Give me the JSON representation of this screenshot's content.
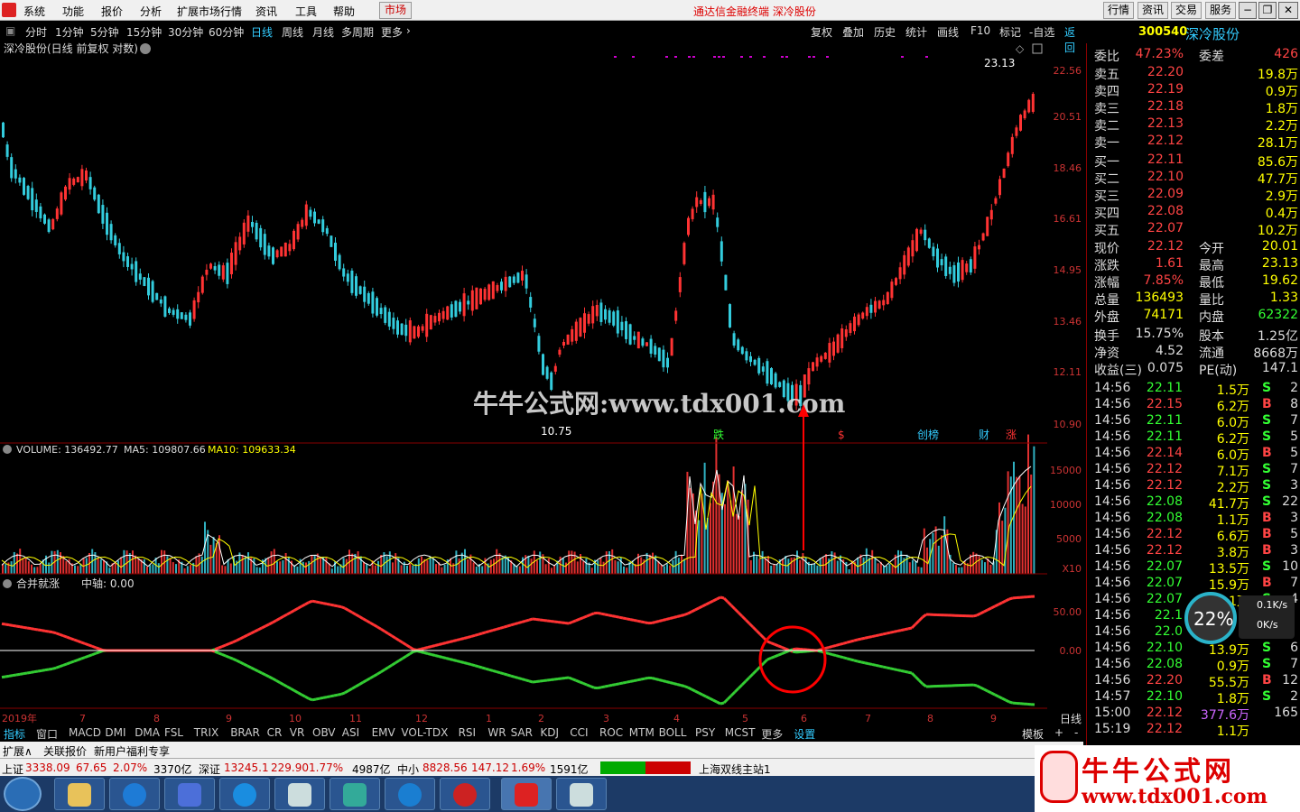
{
  "menu": {
    "items": [
      "系统",
      "功能",
      "报价",
      "分析",
      "扩展市场行情",
      "资讯",
      "工具",
      "帮助"
    ],
    "market": "市场",
    "title": "通达信金融终端  深冷股份",
    "right": [
      "行情",
      "资讯",
      "交易",
      "服务"
    ]
  },
  "toolbar": {
    "periods": [
      "分时",
      "1分钟",
      "5分钟",
      "15分钟",
      "30分钟",
      "60分钟",
      "日线",
      "周线",
      "月线",
      "多周期",
      "更多"
    ],
    "active": "日线",
    "right": [
      "复权",
      "叠加",
      "历史",
      "统计",
      "画线",
      "F10",
      "标记",
      "-自选",
      "返回"
    ]
  },
  "stock": {
    "code": "300540",
    "name": "深冷股份",
    "chart_title": "深冷股份(日线 前复权 对数)"
  },
  "chart_labels": {
    "high": "23.13",
    "low": "10.75",
    "watermark": "牛牛公式网:www.tdx001.com",
    "events": [
      "跌",
      "$",
      "创榜",
      "财",
      "涨"
    ]
  },
  "volume": {
    "title": "VOLUME: 136492.77",
    "ma5": "MA5: 109807.66",
    "ma10": "MA10: 109633.34",
    "unit": "X10"
  },
  "indicator": {
    "name": "合并就涨",
    "axis": "中轴: 0.00",
    "period": "日线"
  },
  "yaxis_price": [
    "22.56",
    "20.51",
    "18.46",
    "16.61",
    "14.95",
    "13.46",
    "12.11",
    "10.90"
  ],
  "yaxis_vol": [
    "15000",
    "10000",
    "5000"
  ],
  "yaxis_ind": [
    "50.00",
    "0.00"
  ],
  "xaxis": [
    "2019年",
    "7",
    "8",
    "9",
    "10",
    "11",
    "12",
    "1",
    "2",
    "3",
    "4",
    "5",
    "6",
    "7",
    "8",
    "9"
  ],
  "quote": {
    "wb": "委比",
    "wb_v": "47.23%",
    "wc": "委差",
    "wc_v": "426",
    "sells": [
      [
        "卖五",
        "22.20",
        "19.8万"
      ],
      [
        "卖四",
        "22.19",
        "0.9万"
      ],
      [
        "卖三",
        "22.18",
        "1.8万"
      ],
      [
        "卖二",
        "22.13",
        "2.2万"
      ],
      [
        "卖一",
        "22.12",
        "28.1万"
      ]
    ],
    "buys": [
      [
        "买一",
        "22.11",
        "85.6万"
      ],
      [
        "买二",
        "22.10",
        "47.7万"
      ],
      [
        "买三",
        "22.09",
        "2.9万"
      ],
      [
        "买四",
        "22.08",
        "0.4万"
      ],
      [
        "买五",
        "22.07",
        "10.2万"
      ]
    ],
    "stats": [
      [
        "现价",
        "22.12",
        "今开",
        "20.01"
      ],
      [
        "涨跌",
        "1.61",
        "最高",
        "23.13"
      ],
      [
        "涨幅",
        "7.85%",
        "最低",
        "19.62"
      ],
      [
        "总量",
        "136493",
        "量比",
        "1.33"
      ],
      [
        "外盘",
        "74171",
        "内盘",
        "62322"
      ],
      [
        "换手",
        "15.75%",
        "股本",
        "1.25亿"
      ],
      [
        "净资",
        "4.52",
        "流通",
        "8668万"
      ],
      [
        "收益(三)",
        "0.075",
        "PE(动)",
        "147.1"
      ]
    ]
  },
  "ticks": [
    [
      "14:56",
      "22.11",
      "1.5万",
      "S",
      "2"
    ],
    [
      "14:56",
      "22.15",
      "6.2万",
      "B",
      "8"
    ],
    [
      "14:56",
      "22.11",
      "6.0万",
      "S",
      "7"
    ],
    [
      "14:56",
      "22.11",
      "6.2万",
      "S",
      "5"
    ],
    [
      "14:56",
      "22.14",
      "6.0万",
      "B",
      "5"
    ],
    [
      "14:56",
      "22.12",
      "7.1万",
      "S",
      "7"
    ],
    [
      "14:56",
      "22.12",
      "2.2万",
      "S",
      "3"
    ],
    [
      "14:56",
      "22.08",
      "41.7万",
      "S",
      "22"
    ],
    [
      "14:56",
      "22.08",
      "1.1万",
      "B",
      "3"
    ],
    [
      "14:56",
      "22.12",
      "6.6万",
      "B",
      "5"
    ],
    [
      "14:56",
      "22.12",
      "3.8万",
      "B",
      "3"
    ],
    [
      "14:56",
      "22.07",
      "13.5万",
      "S",
      "10"
    ],
    [
      "14:56",
      "22.07",
      "15.9万",
      "B",
      "7"
    ],
    [
      "14:56",
      "22.07",
      "14.1万",
      "S",
      "4"
    ],
    [
      "14:56",
      "22.1",
      "",
      "",
      ""
    ],
    [
      "14:56",
      "22.0",
      "",
      "",
      ""
    ],
    [
      "14:56",
      "22.10",
      "13.9万",
      "S",
      "6"
    ],
    [
      "14:56",
      "22.08",
      "0.9万",
      "S",
      "7"
    ],
    [
      "14:56",
      "22.20",
      "55.5万",
      "B",
      "12"
    ],
    [
      "14:57",
      "22.10",
      "1.8万",
      "S",
      "2"
    ],
    [
      "15:00",
      "22.12",
      "377.6万",
      "",
      "165"
    ],
    [
      "15:19",
      "22.12",
      "1.1万",
      "",
      ""
    ]
  ],
  "speed": {
    "pct": "22%",
    "up": "0.1K/s",
    "down": "0K/s"
  },
  "bottom_tabs": [
    "指标",
    "窗口",
    "MACD",
    "DMI",
    "DMA",
    "FSL",
    "TRIX",
    "BRAR",
    "CR",
    "VR",
    "OBV",
    "ASI",
    "EMV",
    "VOL-TDX",
    "RSI",
    "WR",
    "SAR",
    "KDJ",
    "CCI",
    "ROC",
    "MTM",
    "BOLL",
    "PSY",
    "MCST",
    "更多",
    "设置"
  ],
  "bottom_right": [
    "模板",
    "+",
    "-"
  ],
  "bottom2": [
    "扩展∧",
    "关联报价",
    "新用户福利专享"
  ],
  "status": {
    "sh": "上证",
    "sh_v": "3338.09",
    "sh_c": "67.65",
    "sh_p": "2.07%",
    "sh_a": "3370亿",
    "sz": "深证",
    "sz_v": "13245.1",
    "sz_c": "229.90",
    "sz_p": "1.77%",
    "sz_a": "4987亿",
    "zx": "中小",
    "zx_v": "8828.56",
    "zx_c": "147.12",
    "zx_p": "1.69%",
    "zx_a": "1591亿",
    "server": "上海双线主站1"
  },
  "watermark2": {
    "t1": "牛牛公式网",
    "t2": "www.tdx001.com"
  },
  "colors": {
    "up": "#ff3333",
    "down": "#33ccdd",
    "accent": "#ffff00"
  }
}
